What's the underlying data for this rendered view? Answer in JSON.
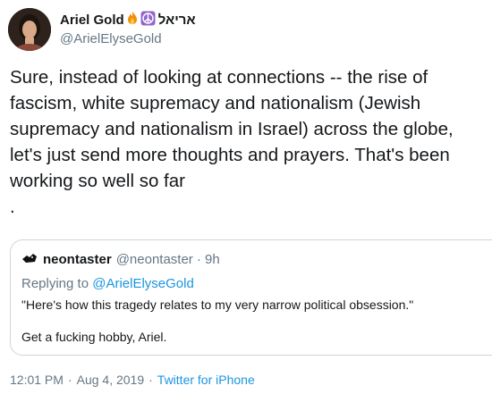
{
  "author": {
    "display_name": "Ariel Gold",
    "hebrew_name": "אריאל",
    "handle": "@ArielElyseGold",
    "emojis": [
      "fire-emoji",
      "peace-symbol-emoji"
    ]
  },
  "tweet": {
    "text": "Sure, instead of looking at connections -- the rise of\nfascism, white supremacy and nationalism (Jewish\nsupremacy and nationalism in Israel) across the globe,\nlet's just send more thoughts and prayers. That's been\nworking so well so far\n."
  },
  "quoted": {
    "display_name": "neontaster",
    "handle": "@neontaster",
    "time": "· 9h",
    "replying_prefix": "Replying to ",
    "replying_to": "@ArielElyseGold",
    "line1": "\"Here's how this tragedy relates to my very narrow political obsession.\"",
    "line2": "Get a fucking hobby, Ariel."
  },
  "footer": {
    "time": "12:01 PM",
    "sep": "·",
    "date": "Aug 4, 2019",
    "sep2": "·",
    "source": "Twitter for iPhone"
  },
  "colors": {
    "text": "#14171a",
    "secondary": "#657786",
    "link": "#1b95e0",
    "border": "#ccd6dd"
  }
}
